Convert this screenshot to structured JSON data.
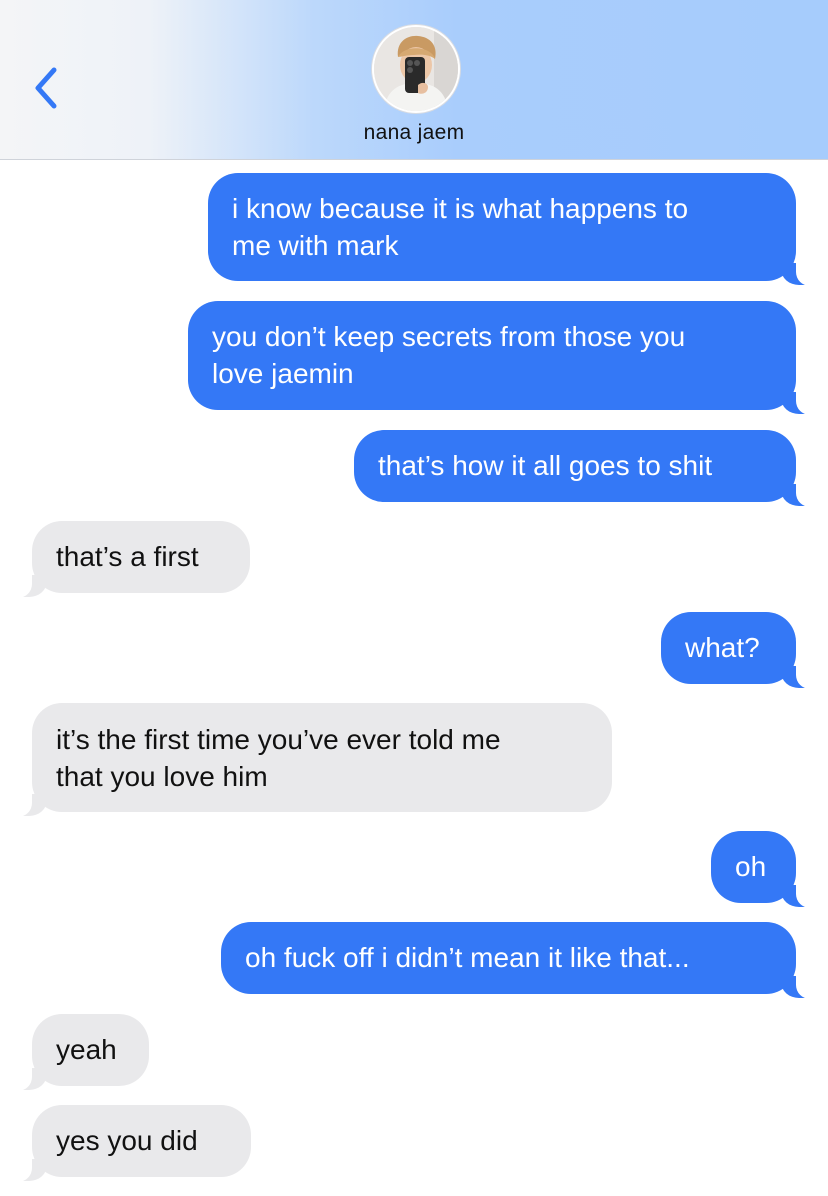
{
  "header": {
    "contact_name": "nana jaem",
    "back_icon": "chevron-left-icon",
    "accent_color": "#3478f6"
  },
  "messages": [
    {
      "direction": "sent",
      "lines": [
        "i know because it is what happens to",
        "me with mark"
      ]
    },
    {
      "direction": "sent",
      "lines": [
        "you don’t keep secrets from those you",
        "love jaemin"
      ]
    },
    {
      "direction": "sent",
      "lines": [
        "that’s how it all goes to shit"
      ]
    },
    {
      "direction": "received",
      "lines": [
        "that’s a first"
      ]
    },
    {
      "direction": "sent",
      "lines": [
        "what?"
      ]
    },
    {
      "direction": "received",
      "lines": [
        "it’s the first time you’ve ever told me",
        "that you love him"
      ]
    },
    {
      "direction": "sent",
      "lines": [
        "oh"
      ]
    },
    {
      "direction": "sent",
      "lines": [
        "oh fuck off i didn’t mean it like that..."
      ]
    },
    {
      "direction": "received",
      "lines": [
        "yeah"
      ]
    },
    {
      "direction": "received",
      "lines": [
        "yes you did"
      ]
    }
  ],
  "colors": {
    "sent_bubble": "#3478f6",
    "received_bubble": "#e9e9eb"
  }
}
